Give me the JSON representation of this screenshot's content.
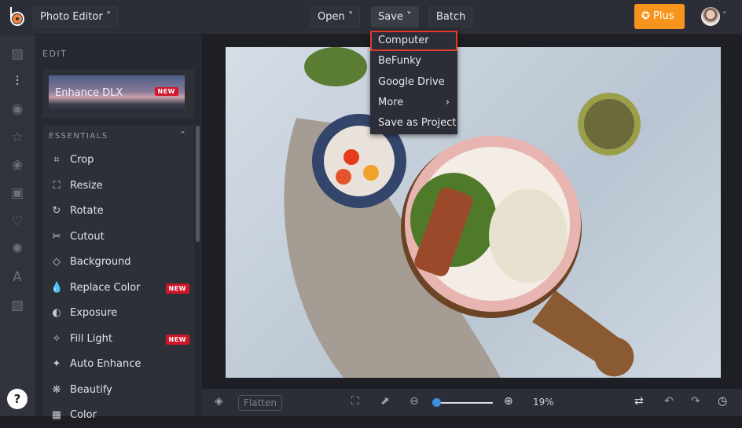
{
  "topbar": {
    "app_menu": "Photo Editor",
    "open": "Open",
    "save": "Save",
    "batch": "Batch",
    "plus": "Plus"
  },
  "save_menu": [
    {
      "label": "Computer"
    },
    {
      "label": "BeFunky"
    },
    {
      "label": "Google Drive"
    },
    {
      "label": "More"
    },
    {
      "label": "Save as Project"
    }
  ],
  "panel": {
    "heading": "EDIT",
    "enhance": {
      "label": "Enhance DLX",
      "badge": "NEW"
    },
    "section": "ESSENTIALS",
    "items": [
      {
        "label": "Crop",
        "icon": "crop-icon",
        "glyph": "⌗"
      },
      {
        "label": "Resize",
        "icon": "resize-icon",
        "glyph": "⛶"
      },
      {
        "label": "Rotate",
        "icon": "rotate-icon",
        "glyph": "↻"
      },
      {
        "label": "Cutout",
        "icon": "scissors-icon",
        "glyph": "✂"
      },
      {
        "label": "Background",
        "icon": "background-icon",
        "glyph": "◇"
      },
      {
        "label": "Replace Color",
        "icon": "drop-icon",
        "glyph": "💧",
        "badge": "NEW"
      },
      {
        "label": "Exposure",
        "icon": "exposure-icon",
        "glyph": "◐"
      },
      {
        "label": "Fill Light",
        "icon": "fill-light-icon",
        "glyph": "✧",
        "badge": "NEW"
      },
      {
        "label": "Auto Enhance",
        "icon": "auto-enhance-icon",
        "glyph": "✦"
      },
      {
        "label": "Beautify",
        "icon": "beautify-icon",
        "glyph": "❋"
      },
      {
        "label": "Color",
        "icon": "color-icon",
        "glyph": "▦"
      }
    ]
  },
  "help": "?",
  "bottom": {
    "flatten": "Flatten",
    "zoom": "19%",
    "zoom_fraction": 0.05
  },
  "colors": {
    "accent": "#f7941d",
    "highlight": "#e03b24",
    "new_badge": "#d0162b",
    "slider": "#3d8fe0"
  }
}
